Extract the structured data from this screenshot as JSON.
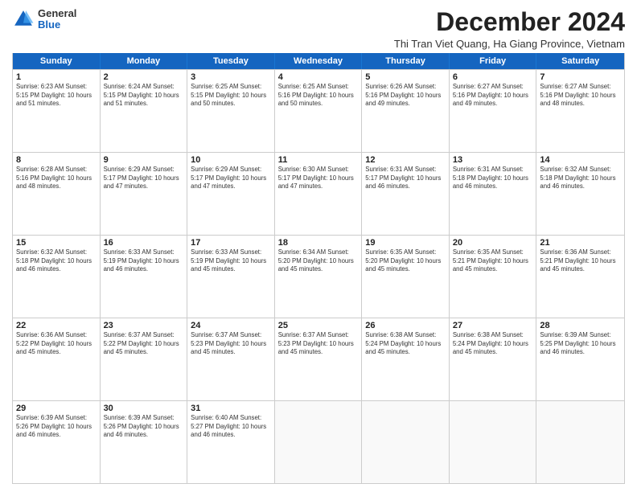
{
  "logo": {
    "general": "General",
    "blue": "Blue"
  },
  "header": {
    "month": "December 2024",
    "location": "Thi Tran Viet Quang, Ha Giang Province, Vietnam"
  },
  "weekdays": [
    "Sunday",
    "Monday",
    "Tuesday",
    "Wednesday",
    "Thursday",
    "Friday",
    "Saturday"
  ],
  "rows": [
    [
      {
        "day": "1",
        "info": "Sunrise: 6:23 AM\nSunset: 5:15 PM\nDaylight: 10 hours\nand 51 minutes."
      },
      {
        "day": "2",
        "info": "Sunrise: 6:24 AM\nSunset: 5:15 PM\nDaylight: 10 hours\nand 51 minutes."
      },
      {
        "day": "3",
        "info": "Sunrise: 6:25 AM\nSunset: 5:15 PM\nDaylight: 10 hours\nand 50 minutes."
      },
      {
        "day": "4",
        "info": "Sunrise: 6:25 AM\nSunset: 5:16 PM\nDaylight: 10 hours\nand 50 minutes."
      },
      {
        "day": "5",
        "info": "Sunrise: 6:26 AM\nSunset: 5:16 PM\nDaylight: 10 hours\nand 49 minutes."
      },
      {
        "day": "6",
        "info": "Sunrise: 6:27 AM\nSunset: 5:16 PM\nDaylight: 10 hours\nand 49 minutes."
      },
      {
        "day": "7",
        "info": "Sunrise: 6:27 AM\nSunset: 5:16 PM\nDaylight: 10 hours\nand 48 minutes."
      }
    ],
    [
      {
        "day": "8",
        "info": "Sunrise: 6:28 AM\nSunset: 5:16 PM\nDaylight: 10 hours\nand 48 minutes."
      },
      {
        "day": "9",
        "info": "Sunrise: 6:29 AM\nSunset: 5:17 PM\nDaylight: 10 hours\nand 47 minutes."
      },
      {
        "day": "10",
        "info": "Sunrise: 6:29 AM\nSunset: 5:17 PM\nDaylight: 10 hours\nand 47 minutes."
      },
      {
        "day": "11",
        "info": "Sunrise: 6:30 AM\nSunset: 5:17 PM\nDaylight: 10 hours\nand 47 minutes."
      },
      {
        "day": "12",
        "info": "Sunrise: 6:31 AM\nSunset: 5:17 PM\nDaylight: 10 hours\nand 46 minutes."
      },
      {
        "day": "13",
        "info": "Sunrise: 6:31 AM\nSunset: 5:18 PM\nDaylight: 10 hours\nand 46 minutes."
      },
      {
        "day": "14",
        "info": "Sunrise: 6:32 AM\nSunset: 5:18 PM\nDaylight: 10 hours\nand 46 minutes."
      }
    ],
    [
      {
        "day": "15",
        "info": "Sunrise: 6:32 AM\nSunset: 5:18 PM\nDaylight: 10 hours\nand 46 minutes."
      },
      {
        "day": "16",
        "info": "Sunrise: 6:33 AM\nSunset: 5:19 PM\nDaylight: 10 hours\nand 46 minutes."
      },
      {
        "day": "17",
        "info": "Sunrise: 6:33 AM\nSunset: 5:19 PM\nDaylight: 10 hours\nand 45 minutes."
      },
      {
        "day": "18",
        "info": "Sunrise: 6:34 AM\nSunset: 5:20 PM\nDaylight: 10 hours\nand 45 minutes."
      },
      {
        "day": "19",
        "info": "Sunrise: 6:35 AM\nSunset: 5:20 PM\nDaylight: 10 hours\nand 45 minutes."
      },
      {
        "day": "20",
        "info": "Sunrise: 6:35 AM\nSunset: 5:21 PM\nDaylight: 10 hours\nand 45 minutes."
      },
      {
        "day": "21",
        "info": "Sunrise: 6:36 AM\nSunset: 5:21 PM\nDaylight: 10 hours\nand 45 minutes."
      }
    ],
    [
      {
        "day": "22",
        "info": "Sunrise: 6:36 AM\nSunset: 5:22 PM\nDaylight: 10 hours\nand 45 minutes."
      },
      {
        "day": "23",
        "info": "Sunrise: 6:37 AM\nSunset: 5:22 PM\nDaylight: 10 hours\nand 45 minutes."
      },
      {
        "day": "24",
        "info": "Sunrise: 6:37 AM\nSunset: 5:23 PM\nDaylight: 10 hours\nand 45 minutes."
      },
      {
        "day": "25",
        "info": "Sunrise: 6:37 AM\nSunset: 5:23 PM\nDaylight: 10 hours\nand 45 minutes."
      },
      {
        "day": "26",
        "info": "Sunrise: 6:38 AM\nSunset: 5:24 PM\nDaylight: 10 hours\nand 45 minutes."
      },
      {
        "day": "27",
        "info": "Sunrise: 6:38 AM\nSunset: 5:24 PM\nDaylight: 10 hours\nand 45 minutes."
      },
      {
        "day": "28",
        "info": "Sunrise: 6:39 AM\nSunset: 5:25 PM\nDaylight: 10 hours\nand 46 minutes."
      }
    ],
    [
      {
        "day": "29",
        "info": "Sunrise: 6:39 AM\nSunset: 5:26 PM\nDaylight: 10 hours\nand 46 minutes."
      },
      {
        "day": "30",
        "info": "Sunrise: 6:39 AM\nSunset: 5:26 PM\nDaylight: 10 hours\nand 46 minutes."
      },
      {
        "day": "31",
        "info": "Sunrise: 6:40 AM\nSunset: 5:27 PM\nDaylight: 10 hours\nand 46 minutes."
      },
      {
        "day": "",
        "info": ""
      },
      {
        "day": "",
        "info": ""
      },
      {
        "day": "",
        "info": ""
      },
      {
        "day": "",
        "info": ""
      }
    ]
  ]
}
